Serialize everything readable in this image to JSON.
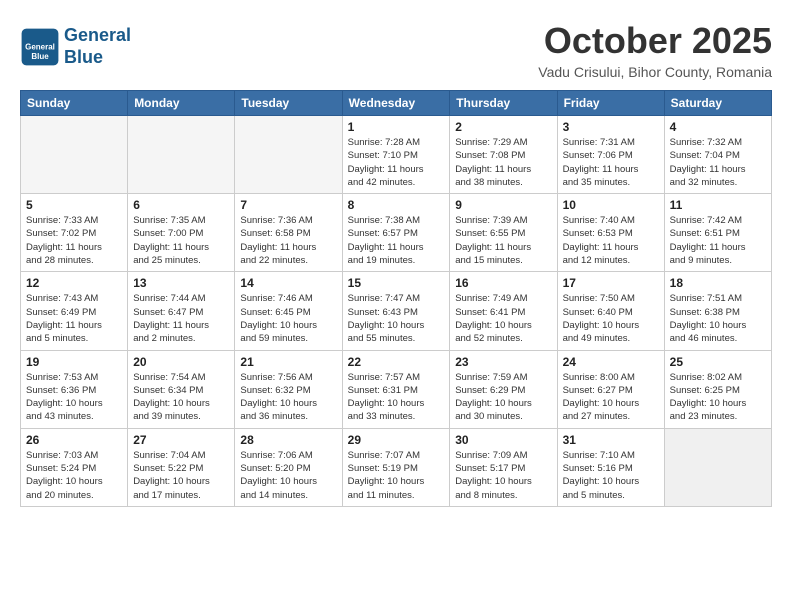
{
  "header": {
    "logo_line1": "General",
    "logo_line2": "Blue",
    "month_title": "October 2025",
    "location": "Vadu Crisului, Bihor County, Romania"
  },
  "weekdays": [
    "Sunday",
    "Monday",
    "Tuesday",
    "Wednesday",
    "Thursday",
    "Friday",
    "Saturday"
  ],
  "weeks": [
    [
      {
        "day": "",
        "info": ""
      },
      {
        "day": "",
        "info": ""
      },
      {
        "day": "",
        "info": ""
      },
      {
        "day": "1",
        "info": "Sunrise: 7:28 AM\nSunset: 7:10 PM\nDaylight: 11 hours\nand 42 minutes."
      },
      {
        "day": "2",
        "info": "Sunrise: 7:29 AM\nSunset: 7:08 PM\nDaylight: 11 hours\nand 38 minutes."
      },
      {
        "day": "3",
        "info": "Sunrise: 7:31 AM\nSunset: 7:06 PM\nDaylight: 11 hours\nand 35 minutes."
      },
      {
        "day": "4",
        "info": "Sunrise: 7:32 AM\nSunset: 7:04 PM\nDaylight: 11 hours\nand 32 minutes."
      }
    ],
    [
      {
        "day": "5",
        "info": "Sunrise: 7:33 AM\nSunset: 7:02 PM\nDaylight: 11 hours\nand 28 minutes."
      },
      {
        "day": "6",
        "info": "Sunrise: 7:35 AM\nSunset: 7:00 PM\nDaylight: 11 hours\nand 25 minutes."
      },
      {
        "day": "7",
        "info": "Sunrise: 7:36 AM\nSunset: 6:58 PM\nDaylight: 11 hours\nand 22 minutes."
      },
      {
        "day": "8",
        "info": "Sunrise: 7:38 AM\nSunset: 6:57 PM\nDaylight: 11 hours\nand 19 minutes."
      },
      {
        "day": "9",
        "info": "Sunrise: 7:39 AM\nSunset: 6:55 PM\nDaylight: 11 hours\nand 15 minutes."
      },
      {
        "day": "10",
        "info": "Sunrise: 7:40 AM\nSunset: 6:53 PM\nDaylight: 11 hours\nand 12 minutes."
      },
      {
        "day": "11",
        "info": "Sunrise: 7:42 AM\nSunset: 6:51 PM\nDaylight: 11 hours\nand 9 minutes."
      }
    ],
    [
      {
        "day": "12",
        "info": "Sunrise: 7:43 AM\nSunset: 6:49 PM\nDaylight: 11 hours\nand 5 minutes."
      },
      {
        "day": "13",
        "info": "Sunrise: 7:44 AM\nSunset: 6:47 PM\nDaylight: 11 hours\nand 2 minutes."
      },
      {
        "day": "14",
        "info": "Sunrise: 7:46 AM\nSunset: 6:45 PM\nDaylight: 10 hours\nand 59 minutes."
      },
      {
        "day": "15",
        "info": "Sunrise: 7:47 AM\nSunset: 6:43 PM\nDaylight: 10 hours\nand 55 minutes."
      },
      {
        "day": "16",
        "info": "Sunrise: 7:49 AM\nSunset: 6:41 PM\nDaylight: 10 hours\nand 52 minutes."
      },
      {
        "day": "17",
        "info": "Sunrise: 7:50 AM\nSunset: 6:40 PM\nDaylight: 10 hours\nand 49 minutes."
      },
      {
        "day": "18",
        "info": "Sunrise: 7:51 AM\nSunset: 6:38 PM\nDaylight: 10 hours\nand 46 minutes."
      }
    ],
    [
      {
        "day": "19",
        "info": "Sunrise: 7:53 AM\nSunset: 6:36 PM\nDaylight: 10 hours\nand 43 minutes."
      },
      {
        "day": "20",
        "info": "Sunrise: 7:54 AM\nSunset: 6:34 PM\nDaylight: 10 hours\nand 39 minutes."
      },
      {
        "day": "21",
        "info": "Sunrise: 7:56 AM\nSunset: 6:32 PM\nDaylight: 10 hours\nand 36 minutes."
      },
      {
        "day": "22",
        "info": "Sunrise: 7:57 AM\nSunset: 6:31 PM\nDaylight: 10 hours\nand 33 minutes."
      },
      {
        "day": "23",
        "info": "Sunrise: 7:59 AM\nSunset: 6:29 PM\nDaylight: 10 hours\nand 30 minutes."
      },
      {
        "day": "24",
        "info": "Sunrise: 8:00 AM\nSunset: 6:27 PM\nDaylight: 10 hours\nand 27 minutes."
      },
      {
        "day": "25",
        "info": "Sunrise: 8:02 AM\nSunset: 6:25 PM\nDaylight: 10 hours\nand 23 minutes."
      }
    ],
    [
      {
        "day": "26",
        "info": "Sunrise: 7:03 AM\nSunset: 5:24 PM\nDaylight: 10 hours\nand 20 minutes."
      },
      {
        "day": "27",
        "info": "Sunrise: 7:04 AM\nSunset: 5:22 PM\nDaylight: 10 hours\nand 17 minutes."
      },
      {
        "day": "28",
        "info": "Sunrise: 7:06 AM\nSunset: 5:20 PM\nDaylight: 10 hours\nand 14 minutes."
      },
      {
        "day": "29",
        "info": "Sunrise: 7:07 AM\nSunset: 5:19 PM\nDaylight: 10 hours\nand 11 minutes."
      },
      {
        "day": "30",
        "info": "Sunrise: 7:09 AM\nSunset: 5:17 PM\nDaylight: 10 hours\nand 8 minutes."
      },
      {
        "day": "31",
        "info": "Sunrise: 7:10 AM\nSunset: 5:16 PM\nDaylight: 10 hours\nand 5 minutes."
      },
      {
        "day": "",
        "info": ""
      }
    ]
  ]
}
